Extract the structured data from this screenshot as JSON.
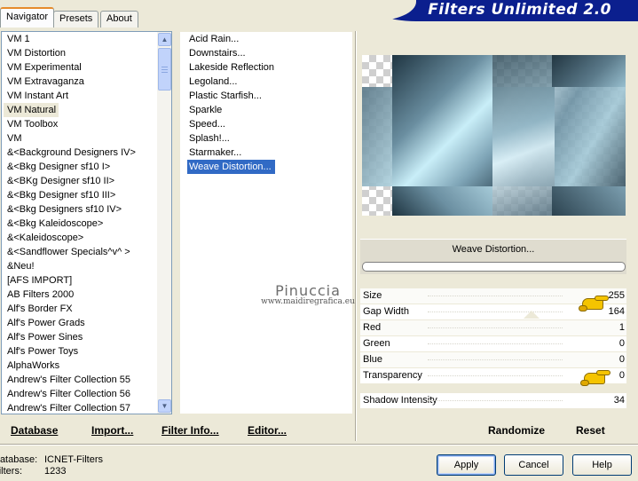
{
  "app": {
    "title": "Filters Unlimited 2.0"
  },
  "tabs": [
    {
      "label": "Navigator",
      "active": true
    },
    {
      "label": "Presets",
      "active": false
    },
    {
      "label": "About",
      "active": false
    }
  ],
  "categories": {
    "selected": "VM Natural",
    "items": [
      "VM 1",
      "VM Distortion",
      "VM Experimental",
      "VM Extravaganza",
      "VM Instant Art",
      "VM Natural",
      "VM Toolbox",
      "VM",
      "&<Background Designers IV>",
      "&<Bkg Designer sf10 I>",
      "&<BKg Designer sf10 II>",
      "&<Bkg Designer sf10 III>",
      "&<Bkg Designers sf10 IV>",
      "&<Bkg Kaleidoscope>",
      "&<Kaleidoscope>",
      "&<Sandflower Specials^v^ >",
      "&Neu!",
      "[AFS IMPORT]",
      "AB Filters 2000",
      "Alf's Border FX",
      "Alf's Power Grads",
      "Alf's Power Sines",
      "Alf's Power Toys",
      "AlphaWorks",
      "Andrew's Filter Collection 55",
      "Andrew's Filter Collection 56",
      "Andrew's Filter Collection 57"
    ]
  },
  "filters": {
    "selected": "Weave Distortion...",
    "items": [
      "Acid Rain...",
      "Downstairs...",
      "Lakeside Reflection",
      "Legoland...",
      "Plastic Starfish...",
      "Sparkle",
      "Speed...",
      "Splash!...",
      "Starmaker...",
      "Weave Distortion..."
    ]
  },
  "preview": {
    "filter_name": "Weave Distortion...",
    "progress": 0
  },
  "watermark": {
    "title": "Pinuccia",
    "url": "www.maidiregrafica.eu"
  },
  "parameters": [
    {
      "label": "Size",
      "value": "255"
    },
    {
      "label": "Gap Width",
      "value": "164"
    },
    {
      "label": "Red",
      "value": "1"
    },
    {
      "label": "Green",
      "value": "0"
    },
    {
      "label": "Blue",
      "value": "0"
    },
    {
      "label": "Transparency",
      "value": "0"
    },
    {
      "label": "Shadow Intensity",
      "value": "34"
    }
  ],
  "toolbar": {
    "database": "Database",
    "import": "Import...",
    "filter_info": "Filter Info...",
    "editor": "Editor...",
    "randomize": "Randomize",
    "reset": "Reset"
  },
  "status": {
    "database_label": "Database:",
    "database_value": "ICNET-Filters",
    "filters_label": "Filters:",
    "filters_value": "1233"
  },
  "buttons": {
    "apply": "Apply",
    "cancel": "Cancel",
    "help": "Help"
  },
  "colors": {
    "banner": "#0b1f8e",
    "selection": "#316ac5",
    "dialog": "#ece9d8",
    "pointer_hand": "#f5c400"
  },
  "icons": {
    "scroll_up": "chevron-up-icon",
    "scroll_down": "chevron-down-icon",
    "pointer": "pointing-hand-icon"
  }
}
